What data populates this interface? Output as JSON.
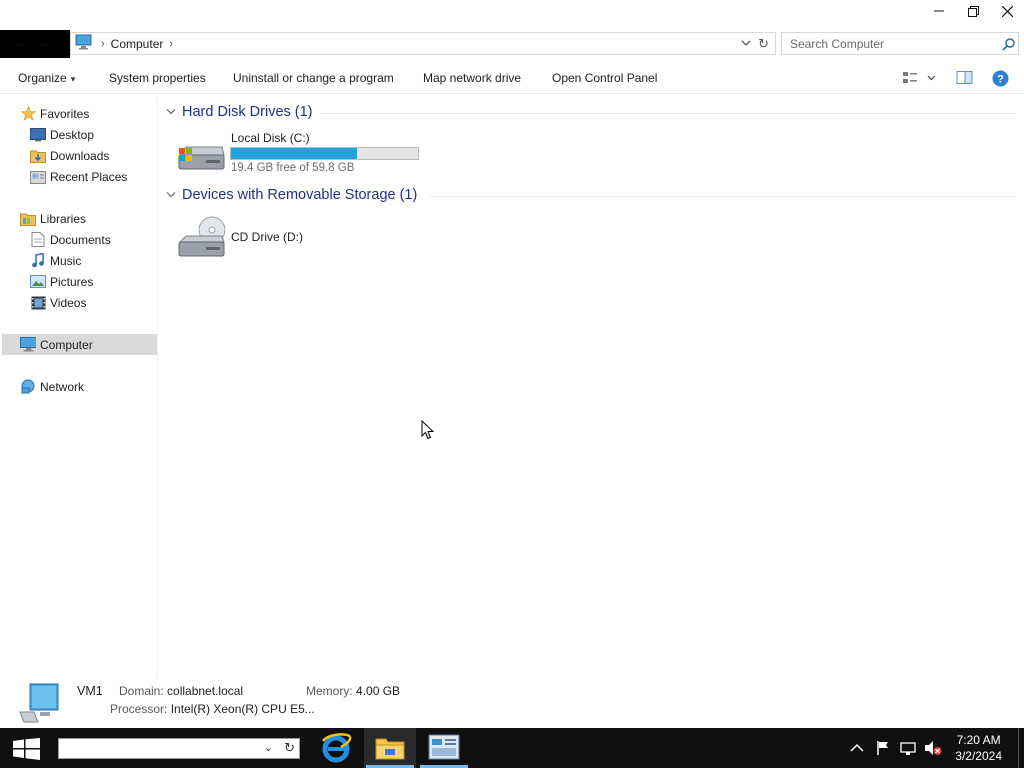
{
  "window": {
    "caption_buttons": [
      "minimize-icon",
      "restore-icon",
      "close-icon"
    ]
  },
  "address_bar": {
    "location_icon": "computer-icon",
    "crumbs": [
      "Computer"
    ],
    "search_placeholder": "Search Computer"
  },
  "command_bar": {
    "organize": "Organize",
    "system_properties": "System properties",
    "uninstall": "Uninstall or change a program",
    "map_drive": "Map network drive",
    "open_control_panel": "Open Control Panel",
    "right_icons": [
      "view-options-icon",
      "preview-pane-icon",
      "help-icon"
    ]
  },
  "nav": {
    "favorites": "Favorites",
    "desktop": "Desktop",
    "downloads": "Downloads",
    "recent_places": "Recent Places",
    "libraries": "Libraries",
    "documents": "Documents",
    "music": "Music",
    "pictures": "Pictures",
    "videos": "Videos",
    "computer": "Computer",
    "network": "Network"
  },
  "groups": {
    "hdd": {
      "title": "Hard Disk Drives (1)",
      "drives": [
        {
          "name": "Local Disk (C:)",
          "free_text": "19.4 GB free of 59.8 GB",
          "used_fraction": 0.676
        }
      ]
    },
    "removable": {
      "title": "Devices with Removable Storage (1)",
      "drives": [
        {
          "name": "CD Drive (D:)"
        }
      ]
    }
  },
  "details": {
    "name": "VM1",
    "domain_label": "Domain:",
    "domain": "collabnet.local",
    "memory_label": "Memory:",
    "memory": "4.00 GB",
    "processor_label": "Processor:",
    "processor": "Intel(R) Xeon(R) CPU E5..."
  },
  "taskbar": {
    "apps": [
      "internet-explorer-icon",
      "file-explorer-icon",
      "server-manager-icon"
    ],
    "tray_icons": [
      "show-hidden-icons-icon",
      "action-center-flag-icon",
      "network-icon",
      "volume-muted-icon"
    ],
    "time": "7:20 AM",
    "date": "3/2/2024"
  }
}
